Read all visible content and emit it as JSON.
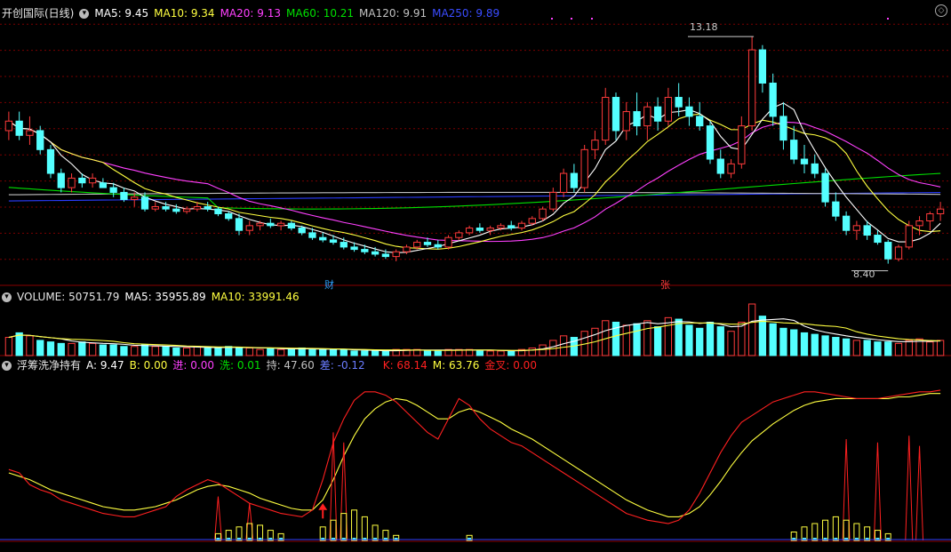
{
  "colors": {
    "up": "#ff3b3b",
    "down": "#54ffff",
    "ma5": "#ffffff",
    "ma10": "#ffff40",
    "ma20": "#ff40ff",
    "ma60": "#00e000",
    "ma120": "#c0c0c0",
    "ma250": "#2a3cff",
    "k": "#ff2020",
    "m": "#ffff40",
    "grid": "#7a0000"
  },
  "price_panel": {
    "title": "开创国际(日线)",
    "ma5_label": "MA5: 9.45",
    "ma10_label": "MA10: 9.34",
    "ma20_label": "MA20: 9.13",
    "ma60_label": "MA60: 10.21",
    "ma120_label": "MA120: 9.91",
    "ma250_label": "MA250: 9.89",
    "high_label": "13.18",
    "low_label": "8.40",
    "tag_cai": "财",
    "tag_zhang": "张"
  },
  "volume_panel": {
    "vol_label": "VOLUME: 50751.79",
    "ma5_label": "MA5: 35955.89",
    "ma10_label": "MA10: 33991.46"
  },
  "indicator_panel": {
    "name": "浮筹洗净持有",
    "a_label": "A: 9.47",
    "b_label": "B: 0.00",
    "jin_label": "进: 0.00",
    "xi_label": "洗: 0.01",
    "chi_label": "持: 47.60",
    "cha_label": "差: -0.12",
    "k_label": "K: 68.14",
    "m_label": "M: 63.76",
    "jincha_label": "金叉: 0.00"
  },
  "chart_data": {
    "type": "candlestick",
    "title": "开创国际(日线)",
    "price_ylim": [
      8.0,
      13.5
    ],
    "price_marked": {
      "high": 13.18,
      "low": 8.4
    },
    "price_grid_levels": [
      13.44,
      12.89,
      12.34,
      11.79,
      11.24,
      10.69,
      10.14,
      9.59,
      9.04,
      8.49
    ],
    "candle_count": 90,
    "ohlc": [
      [
        11.2,
        11.6,
        11.0,
        11.4
      ],
      [
        11.4,
        11.6,
        11.0,
        11.1
      ],
      [
        11.1,
        11.5,
        10.9,
        11.2
      ],
      [
        11.2,
        11.3,
        10.7,
        10.8
      ],
      [
        10.8,
        10.9,
        10.2,
        10.3
      ],
      [
        10.3,
        10.4,
        9.9,
        10.0
      ],
      [
        10.0,
        10.3,
        9.9,
        10.2
      ],
      [
        10.2,
        10.3,
        10.0,
        10.1
      ],
      [
        10.1,
        10.3,
        10.0,
        10.2
      ],
      [
        10.1,
        10.2,
        10.0,
        10.0
      ],
      [
        10.0,
        10.1,
        9.8,
        9.9
      ],
      [
        9.9,
        10.0,
        9.7,
        9.75
      ],
      [
        9.75,
        9.9,
        9.6,
        9.8
      ],
      [
        9.8,
        9.9,
        9.5,
        9.55
      ],
      [
        9.55,
        9.7,
        9.5,
        9.6
      ],
      [
        9.6,
        9.7,
        9.5,
        9.55
      ],
      [
        9.55,
        9.65,
        9.45,
        9.5
      ],
      [
        9.5,
        9.6,
        9.45,
        9.55
      ],
      [
        9.55,
        9.7,
        9.5,
        9.6
      ],
      [
        9.6,
        9.7,
        9.5,
        9.55
      ],
      [
        9.55,
        9.6,
        9.4,
        9.45
      ],
      [
        9.45,
        9.5,
        9.3,
        9.35
      ],
      [
        9.35,
        9.45,
        9.0,
        9.1
      ],
      [
        9.1,
        9.3,
        9.0,
        9.2
      ],
      [
        9.2,
        9.3,
        9.1,
        9.25
      ],
      [
        9.25,
        9.35,
        9.15,
        9.2
      ],
      [
        9.2,
        9.3,
        9.1,
        9.25
      ],
      [
        9.25,
        9.3,
        9.1,
        9.15
      ],
      [
        9.15,
        9.2,
        9.0,
        9.05
      ],
      [
        9.05,
        9.15,
        8.9,
        8.95
      ],
      [
        8.95,
        9.05,
        8.85,
        8.9
      ],
      [
        8.9,
        9.0,
        8.8,
        8.85
      ],
      [
        8.85,
        8.95,
        8.7,
        8.75
      ],
      [
        8.75,
        8.85,
        8.65,
        8.7
      ],
      [
        8.7,
        8.8,
        8.6,
        8.65
      ],
      [
        8.65,
        8.75,
        8.55,
        8.6
      ],
      [
        8.6,
        8.7,
        8.5,
        8.55
      ],
      [
        8.55,
        8.7,
        8.45,
        8.65
      ],
      [
        8.65,
        8.8,
        8.6,
        8.75
      ],
      [
        8.75,
        8.9,
        8.7,
        8.85
      ],
      [
        8.85,
        8.95,
        8.75,
        8.8
      ],
      [
        8.8,
        8.9,
        8.7,
        8.75
      ],
      [
        8.75,
        9.0,
        8.7,
        8.95
      ],
      [
        8.95,
        9.1,
        8.9,
        9.05
      ],
      [
        9.05,
        9.2,
        9.0,
        9.15
      ],
      [
        9.15,
        9.25,
        9.05,
        9.1
      ],
      [
        9.1,
        9.2,
        9.0,
        9.15
      ],
      [
        9.15,
        9.25,
        9.1,
        9.2
      ],
      [
        9.2,
        9.3,
        9.1,
        9.15
      ],
      [
        9.15,
        9.3,
        9.1,
        9.25
      ],
      [
        9.25,
        9.4,
        9.2,
        9.35
      ],
      [
        9.35,
        9.6,
        9.3,
        9.55
      ],
      [
        9.55,
        10.0,
        9.5,
        9.9
      ],
      [
        9.9,
        10.4,
        9.8,
        10.3
      ],
      [
        10.3,
        10.5,
        9.9,
        10.0
      ],
      [
        10.0,
        10.9,
        9.9,
        10.8
      ],
      [
        10.8,
        11.2,
        10.6,
        11.0
      ],
      [
        11.0,
        12.1,
        10.9,
        11.9
      ],
      [
        11.9,
        12.0,
        11.0,
        11.2
      ],
      [
        11.2,
        11.8,
        11.0,
        11.6
      ],
      [
        11.6,
        12.0,
        11.1,
        11.3
      ],
      [
        11.3,
        11.8,
        11.0,
        11.7
      ],
      [
        11.7,
        11.9,
        11.2,
        11.4
      ],
      [
        11.4,
        12.1,
        11.3,
        11.9
      ],
      [
        11.9,
        12.2,
        11.5,
        11.7
      ],
      [
        11.7,
        11.9,
        11.3,
        11.5
      ],
      [
        11.5,
        11.8,
        11.2,
        11.3
      ],
      [
        11.3,
        11.4,
        10.5,
        10.6
      ],
      [
        10.6,
        10.8,
        10.2,
        10.3
      ],
      [
        10.3,
        10.6,
        10.2,
        10.5
      ],
      [
        10.5,
        11.5,
        10.4,
        11.3
      ],
      [
        11.3,
        13.18,
        11.2,
        12.9
      ],
      [
        12.9,
        13.0,
        12.0,
        12.2
      ],
      [
        12.2,
        12.4,
        11.3,
        11.5
      ],
      [
        11.5,
        11.8,
        10.8,
        11.0
      ],
      [
        11.0,
        11.3,
        10.5,
        10.6
      ],
      [
        10.6,
        10.9,
        10.3,
        10.5
      ],
      [
        10.5,
        10.7,
        10.2,
        10.3
      ],
      [
        10.3,
        10.4,
        9.6,
        9.7
      ],
      [
        9.7,
        9.9,
        9.3,
        9.4
      ],
      [
        9.4,
        9.5,
        9.0,
        9.1
      ],
      [
        9.1,
        9.3,
        8.9,
        9.2
      ],
      [
        9.2,
        9.3,
        8.9,
        9.0
      ],
      [
        9.0,
        9.1,
        8.8,
        8.85
      ],
      [
        8.85,
        8.9,
        8.4,
        8.5
      ],
      [
        8.5,
        8.8,
        8.45,
        8.75
      ],
      [
        8.75,
        9.3,
        8.7,
        9.2
      ],
      [
        9.2,
        9.4,
        9.0,
        9.3
      ],
      [
        9.3,
        9.5,
        9.1,
        9.45
      ],
      [
        9.45,
        9.7,
        9.3,
        9.55
      ]
    ],
    "volume": [
      12,
      15,
      13,
      10,
      9,
      8,
      8,
      9,
      8,
      7,
      7,
      6,
      6,
      7,
      6,
      6,
      5,
      5,
      6,
      5,
      5,
      6,
      5,
      5,
      4,
      5,
      4,
      4,
      5,
      4,
      4,
      4,
      4,
      3,
      3,
      3,
      3,
      4,
      4,
      4,
      3,
      3,
      4,
      4,
      4,
      3,
      3,
      3,
      3,
      4,
      5,
      7,
      10,
      13,
      12,
      16,
      18,
      23,
      22,
      20,
      21,
      23,
      19,
      25,
      24,
      20,
      18,
      22,
      19,
      16,
      22,
      34,
      26,
      21,
      18,
      17,
      15,
      14,
      13,
      12,
      11,
      10,
      10,
      9,
      9,
      8,
      10,
      11,
      9,
      10
    ],
    "k_values": [
      42,
      40,
      33,
      30,
      28,
      24,
      22,
      20,
      18,
      16,
      15,
      14,
      14,
      16,
      18,
      20,
      26,
      30,
      33,
      36,
      34,
      30,
      26,
      22,
      20,
      18,
      16,
      15,
      14,
      18,
      36,
      58,
      72,
      83,
      88,
      88,
      86,
      82,
      76,
      70,
      64,
      60,
      72,
      84,
      80,
      72,
      66,
      62,
      58,
      56,
      52,
      48,
      44,
      40,
      36,
      32,
      28,
      24,
      20,
      16,
      14,
      12,
      11,
      10,
      12,
      18,
      28,
      40,
      52,
      62,
      70,
      74,
      78,
      82,
      84,
      86,
      88,
      88,
      87,
      86,
      85,
      84,
      84,
      84,
      85,
      86,
      87,
      88,
      88,
      89
    ],
    "m_values": [
      40,
      38,
      36,
      33,
      30,
      28,
      26,
      24,
      22,
      20,
      19,
      18,
      18,
      19,
      20,
      22,
      24,
      27,
      30,
      32,
      33,
      32,
      30,
      28,
      25,
      23,
      21,
      19,
      18,
      18,
      24,
      36,
      50,
      62,
      72,
      78,
      82,
      84,
      83,
      80,
      76,
      72,
      72,
      76,
      78,
      76,
      73,
      70,
      66,
      63,
      60,
      56,
      52,
      48,
      44,
      40,
      36,
      32,
      28,
      24,
      21,
      18,
      16,
      14,
      14,
      16,
      20,
      27,
      35,
      44,
      52,
      59,
      64,
      69,
      73,
      77,
      80,
      82,
      83,
      84,
      84,
      84,
      84,
      84,
      84,
      85,
      85,
      86,
      87,
      87
    ],
    "indicator_ylim": [
      0,
      100
    ],
    "series": [
      {
        "name": "MA5",
        "values": [
          9.45
        ]
      },
      {
        "name": "MA10",
        "values": [
          9.34
        ]
      },
      {
        "name": "MA20",
        "values": [
          9.13
        ]
      },
      {
        "name": "MA60",
        "values": [
          10.21
        ]
      },
      {
        "name": "MA120",
        "values": [
          9.91
        ]
      },
      {
        "name": "MA250",
        "values": [
          9.89
        ]
      }
    ]
  }
}
